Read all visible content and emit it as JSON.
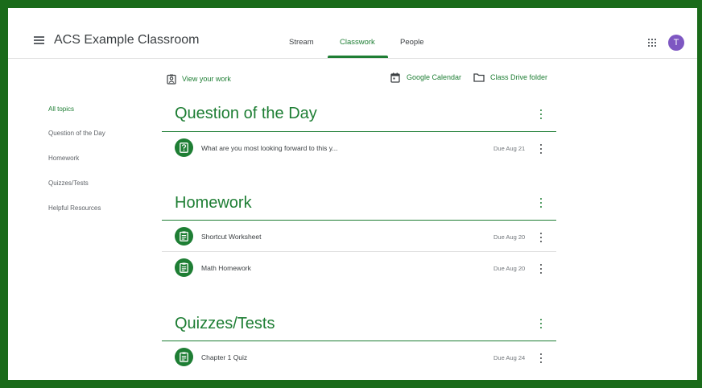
{
  "header": {
    "class_title": "ACS Example Classroom",
    "tabs": [
      {
        "label": "Stream",
        "active": false
      },
      {
        "label": "Classwork",
        "active": true
      },
      {
        "label": "People",
        "active": false
      }
    ],
    "avatar_letter": "T",
    "avatar_color": "#7e57c2"
  },
  "toolbar": {
    "view_work": "View your work",
    "google_calendar": "Google Calendar",
    "drive_folder": "Class Drive folder"
  },
  "sidebar": {
    "items": [
      {
        "label": "All topics",
        "active": true
      },
      {
        "label": "Question of the Day",
        "active": false
      },
      {
        "label": "Homework",
        "active": false
      },
      {
        "label": "Quizzes/Tests",
        "active": false
      },
      {
        "label": "Helpful Resources",
        "active": false
      }
    ]
  },
  "sections": [
    {
      "title": "Question of the Day",
      "items": [
        {
          "icon": "question-icon",
          "title": "What are you most looking forward to this y...",
          "due": "Due Aug 21"
        }
      ]
    },
    {
      "title": "Homework",
      "items": [
        {
          "icon": "assignment-icon",
          "title": "Shortcut Worksheet",
          "due": "Due Aug 20"
        },
        {
          "icon": "assignment-icon",
          "title": "Math Homework",
          "due": "Due Aug 20"
        }
      ]
    },
    {
      "title": "Quizzes/Tests",
      "items": [
        {
          "icon": "assignment-icon",
          "title": "Chapter 1 Quiz",
          "due": "Due Aug 24"
        }
      ]
    }
  ],
  "colors": {
    "brand_green": "#1e7e34",
    "frame_border": "#1a6b1a",
    "text_primary": "#3c4043",
    "text_secondary": "#5f6368"
  }
}
